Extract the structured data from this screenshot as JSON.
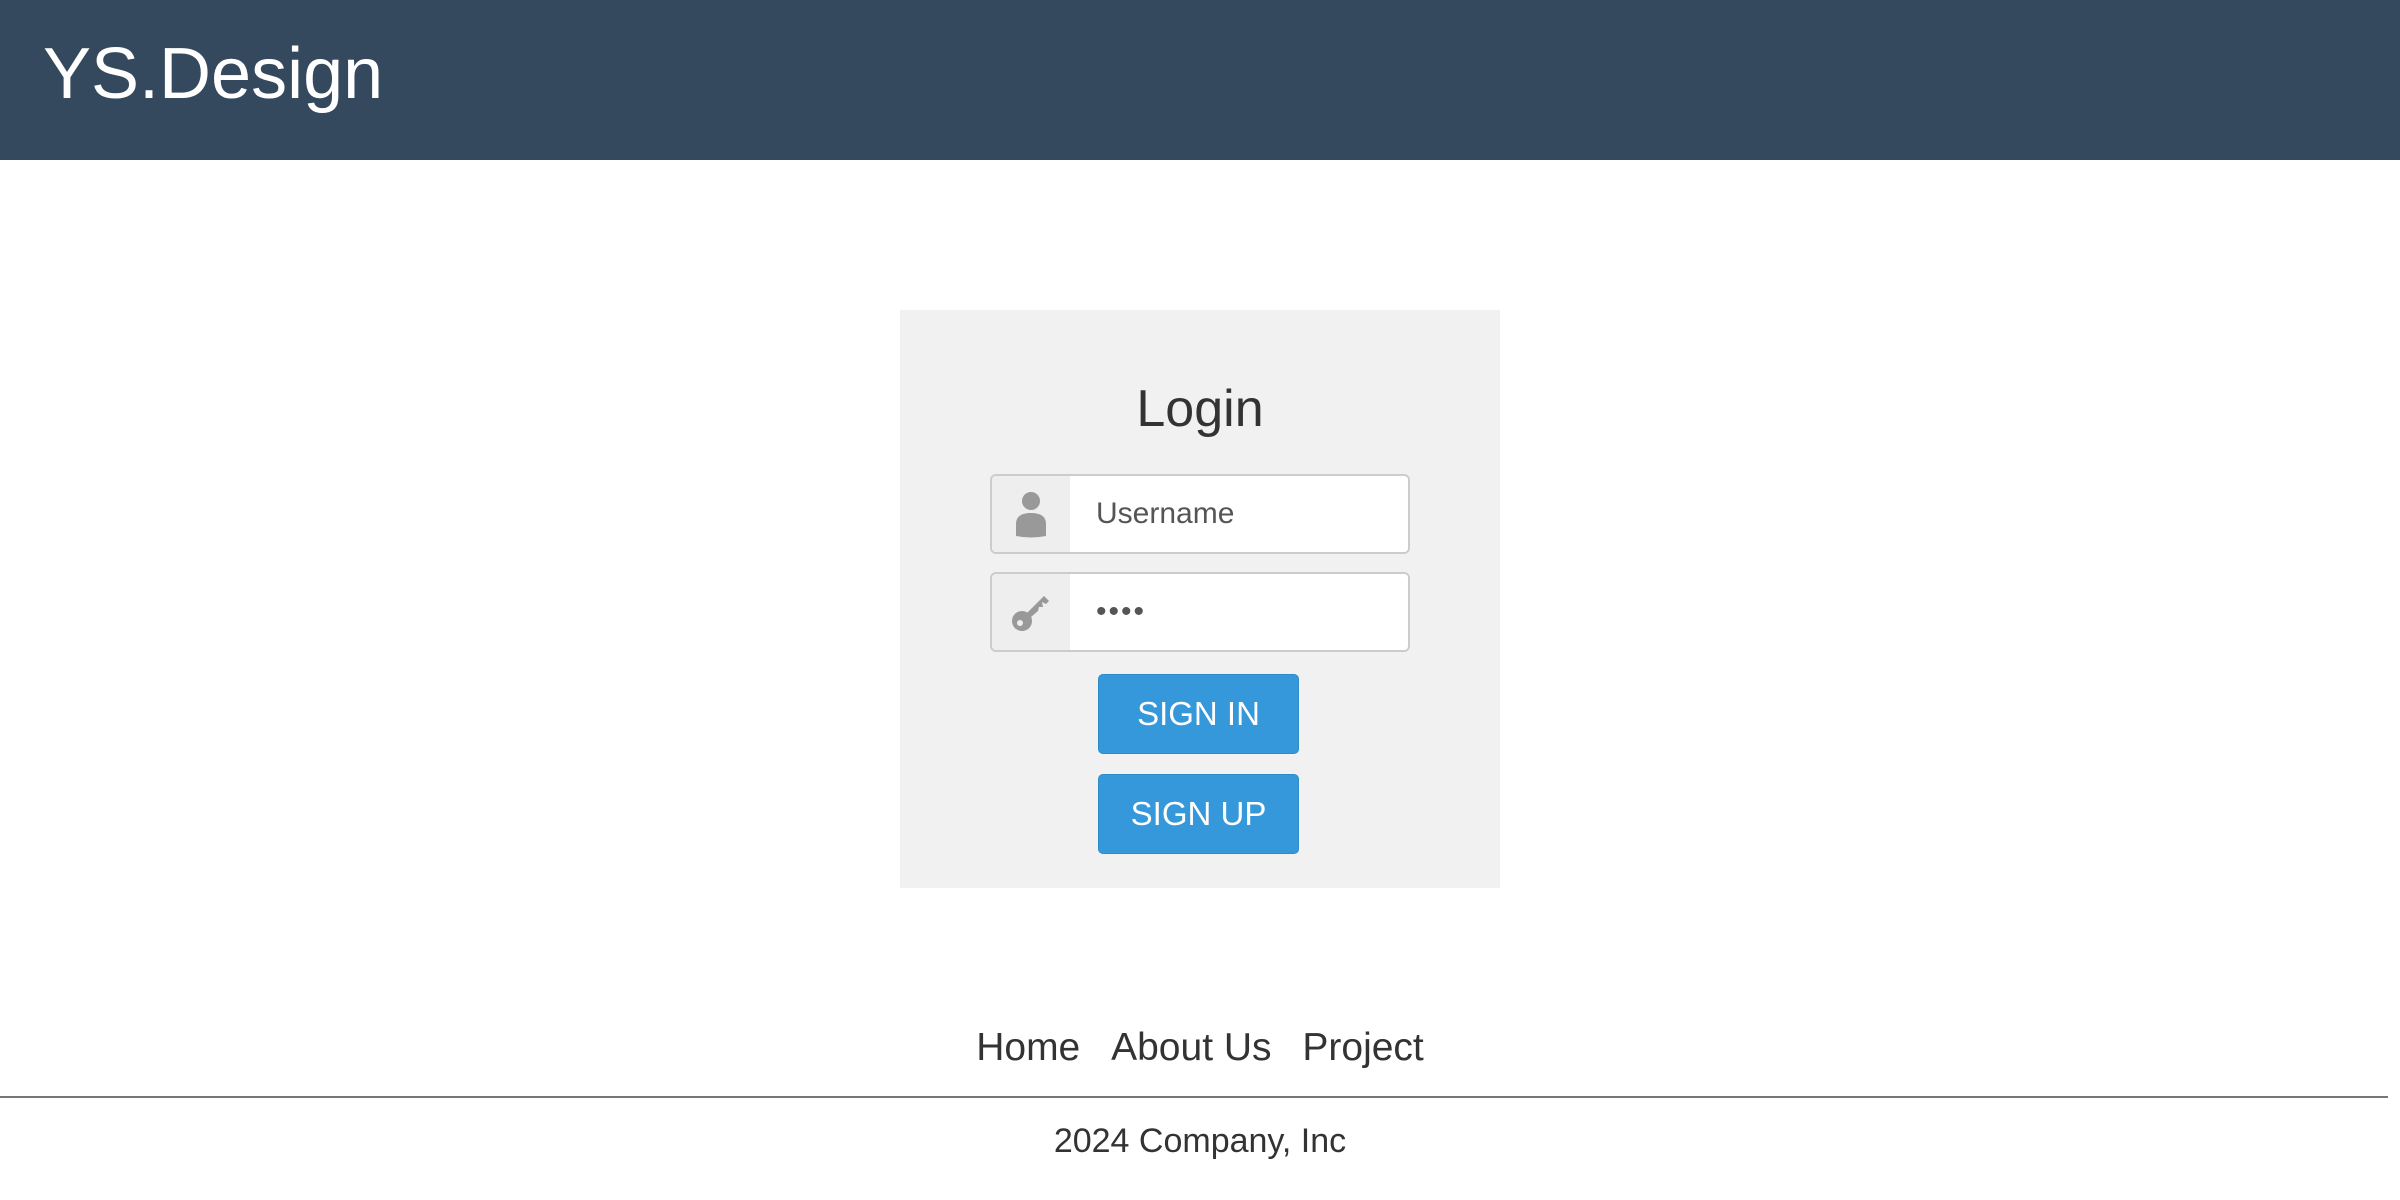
{
  "header": {
    "brand": "YS.Design"
  },
  "login": {
    "title": "Login",
    "username": {
      "placeholder": "Username",
      "value": "",
      "icon": "user-icon"
    },
    "password": {
      "value": "••••",
      "icon": "key-icon"
    },
    "sign_in_label": "SIGN IN",
    "sign_up_label": "SIGN UP"
  },
  "footer": {
    "links": [
      {
        "label": "Home"
      },
      {
        "label": "About Us"
      },
      {
        "label": "Project"
      }
    ],
    "copyright": "2024 Company, Inc"
  },
  "colors": {
    "header_bg": "#34495e",
    "panel_bg": "#f1f1f1",
    "button": "#3498db",
    "icon": "#999999"
  }
}
